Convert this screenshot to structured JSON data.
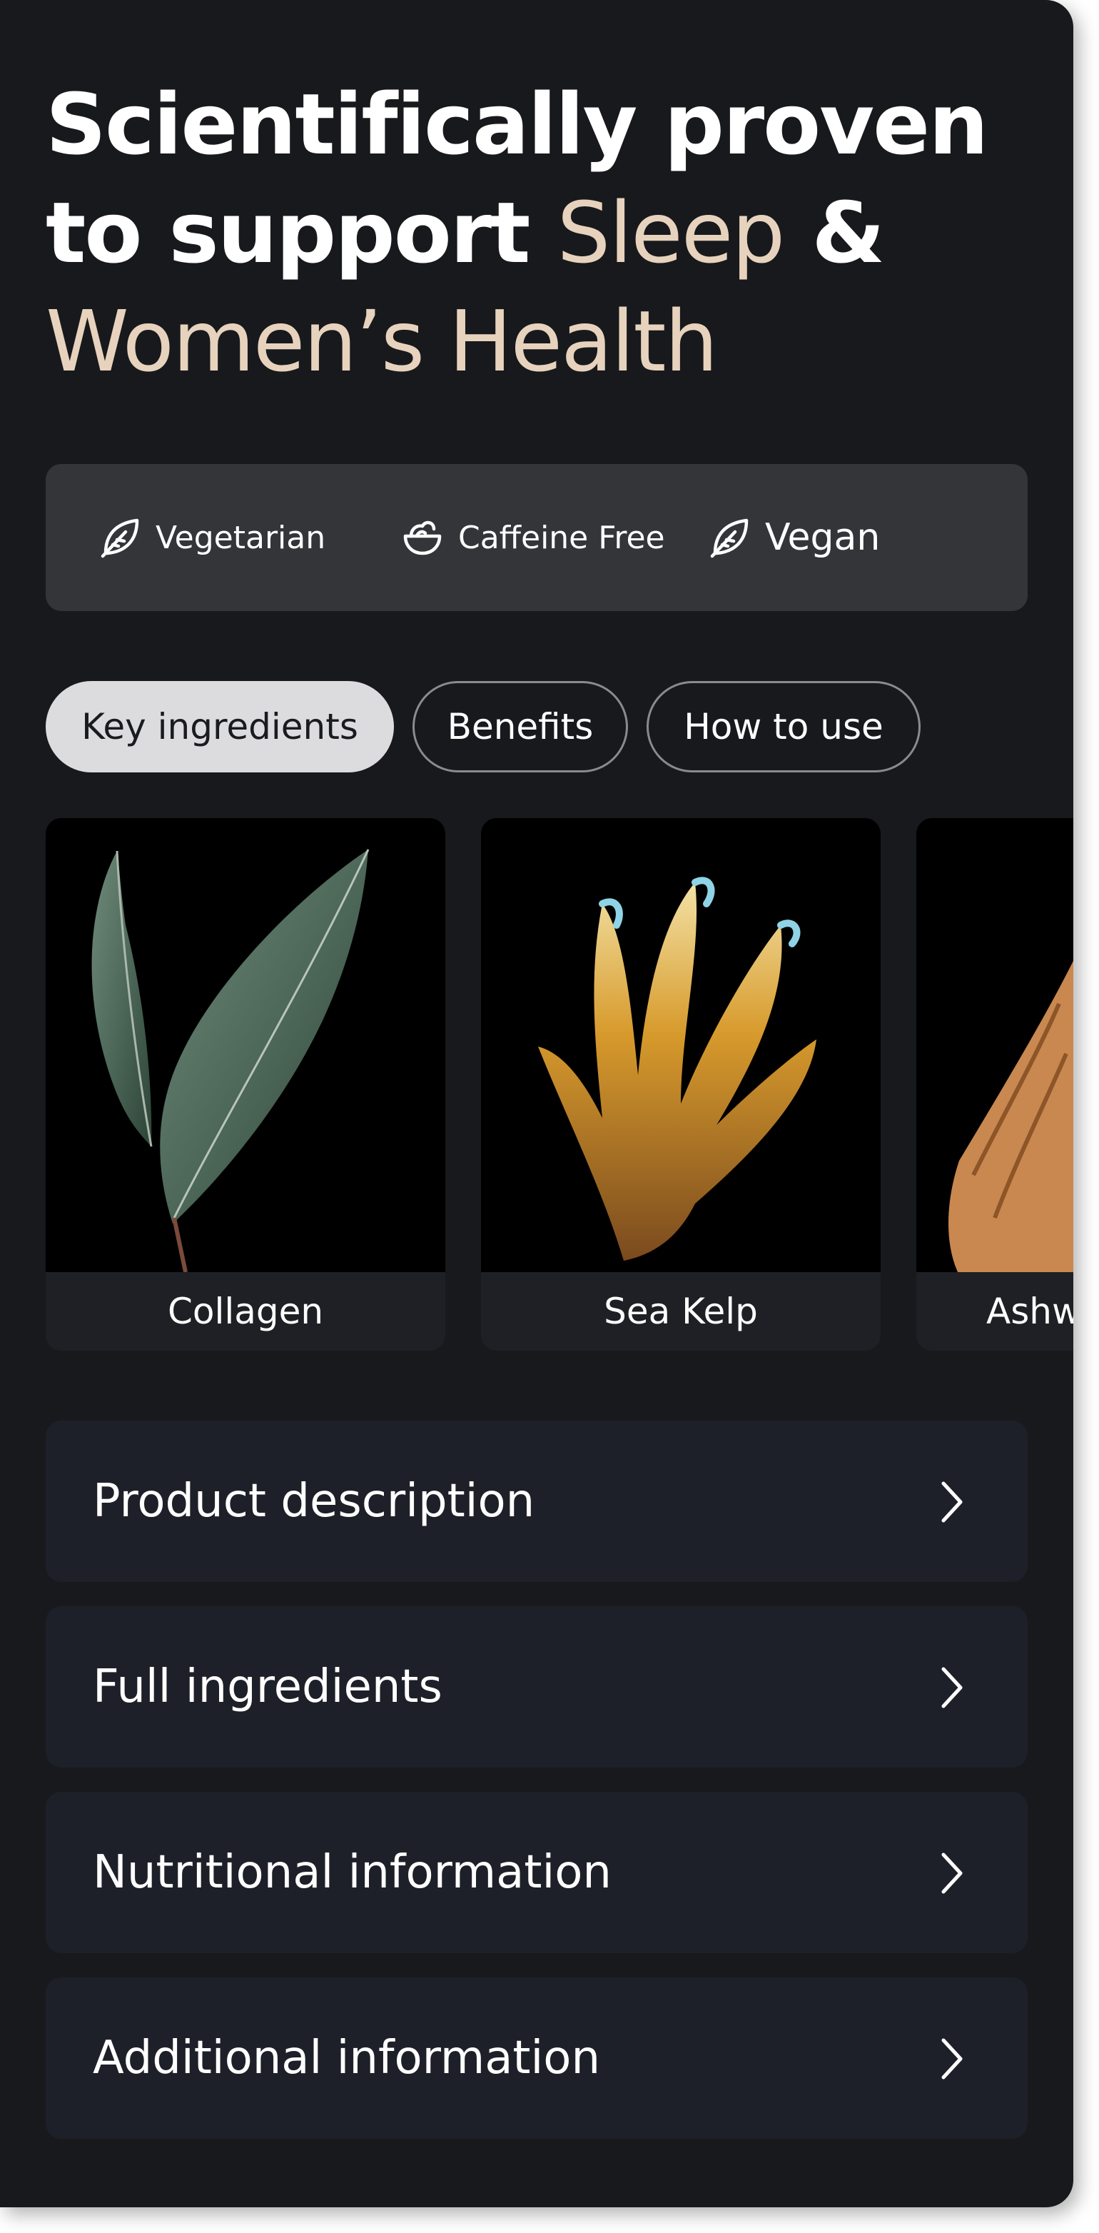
{
  "headline": {
    "part1": "Scientifically proven to support",
    "accent1": "Sleep",
    "part2": "&",
    "accent2": "Women’s Health"
  },
  "attributes": [
    {
      "label": "Vegetarian",
      "icon": "leaf-icon"
    },
    {
      "label": "Caffeine Free",
      "icon": "bowl-icon"
    },
    {
      "label": "Vegan",
      "icon": "leaf-icon"
    }
  ],
  "tabs": [
    {
      "label": "Key ingredients",
      "active": true
    },
    {
      "label": "Benefits",
      "active": false
    },
    {
      "label": "How to use",
      "active": false
    }
  ],
  "ingredients": [
    {
      "label": "Collagen"
    },
    {
      "label": "Sea Kelp"
    },
    {
      "label": "Ashw"
    }
  ],
  "accordion": [
    {
      "label": "Product description"
    },
    {
      "label": "Full ingredients"
    },
    {
      "label": "Nutritional information"
    },
    {
      "label": "Additional information"
    }
  ],
  "colors": {
    "background": "#18191d",
    "accent_text": "#e7d3bd",
    "attributes_bar": "#343539",
    "active_tab": "#dcdcde",
    "accordion_row": "#1e2029"
  }
}
